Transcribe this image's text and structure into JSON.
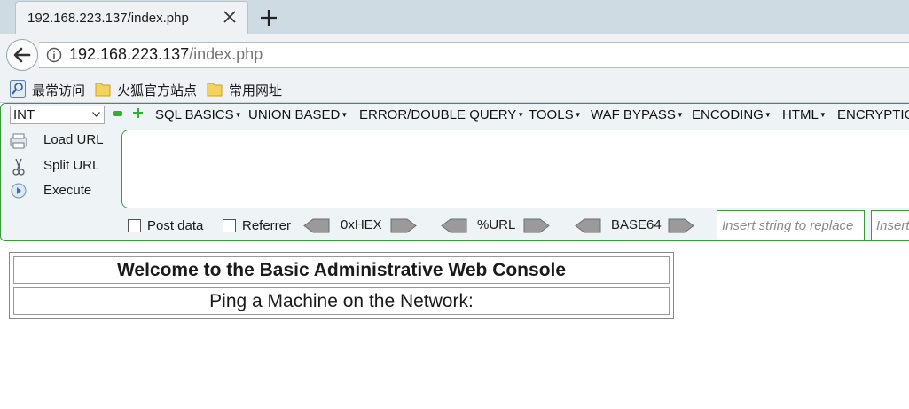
{
  "browser": {
    "tab_title": "192.168.223.137/index.php",
    "url_host": "192.168.223.137",
    "url_path": "/index.php",
    "bookmarks": [
      {
        "label": "最常访问",
        "icon": "most-visited-icon"
      },
      {
        "label": "火狐官方站点",
        "icon": "folder-icon"
      },
      {
        "label": "常用网址",
        "icon": "folder-icon"
      }
    ]
  },
  "hackbar": {
    "select_value": "INT",
    "menu": [
      "SQL BASICS",
      "UNION BASED",
      "ERROR/DOUBLE QUERY",
      "TOOLS",
      "WAF BYPASS",
      "ENCODING",
      "HTML",
      "ENCRYPTIO"
    ],
    "actions": [
      "Load URL",
      "Split URL",
      "Execute"
    ],
    "post_data_label": "Post data",
    "referrer_label": "Referrer",
    "hex_label": "0xHEX",
    "url_label": "%URL",
    "base64_label": "BASE64",
    "replace_placeholder": "Insert string to replace",
    "replace_with_placeholder": "Insert"
  },
  "page": {
    "title": "Welcome to the Basic Administrative Web Console",
    "subtitle": "Ping a Machine on the Network:"
  },
  "colors": {
    "accent_green": "#3a9a3a",
    "tabstrip_bg": "#cfdbe2",
    "toolbar_bg": "#eef2f4"
  }
}
